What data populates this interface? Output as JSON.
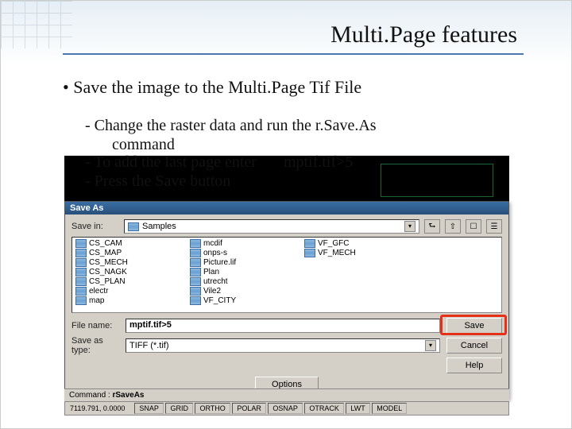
{
  "slide": {
    "title": "Multi.Page features",
    "bullet": "• Save the image to  the Multi.Page Tif File",
    "sub1": "- Change the raster data and run the r.Save.As",
    "sub1b": "command",
    "sub2_left": "- To add the last page enter",
    "sub2_right": "mptif.tif>5",
    "sub3": "- Press the Save button"
  },
  "dialog": {
    "title": "Save As",
    "save_in_label": "Save in:",
    "save_in_value": "Samples",
    "files": [
      "CS_CAM",
      "CS_MAP",
      "CS_MECH",
      "CS_NAGK",
      "CS_PLAN",
      "electr",
      "map",
      "mcdif",
      "onps-s",
      "Picture.lif",
      "Plan",
      "utrecht",
      "Vile2",
      "VF_CITY",
      "VF_GFC",
      "VF_MECH"
    ],
    "file_name_label": "File name:",
    "file_name_value": "mptif.tif>5",
    "save_type_label": "Save as type:",
    "save_type_value": "TIFF (*.tif)",
    "save_btn": "Save",
    "cancel_btn": "Cancel",
    "help_btn": "Help",
    "options_btn": "Options"
  },
  "cmd": {
    "label": "Command : ",
    "value": "rSaveAs"
  },
  "status": {
    "coords": "7119.791, 0.0000",
    "items": [
      "SNAP",
      "GRID",
      "ORTHO",
      "POLAR",
      "OSNAP",
      "OTRACK",
      "LWT",
      "MODEL"
    ]
  }
}
